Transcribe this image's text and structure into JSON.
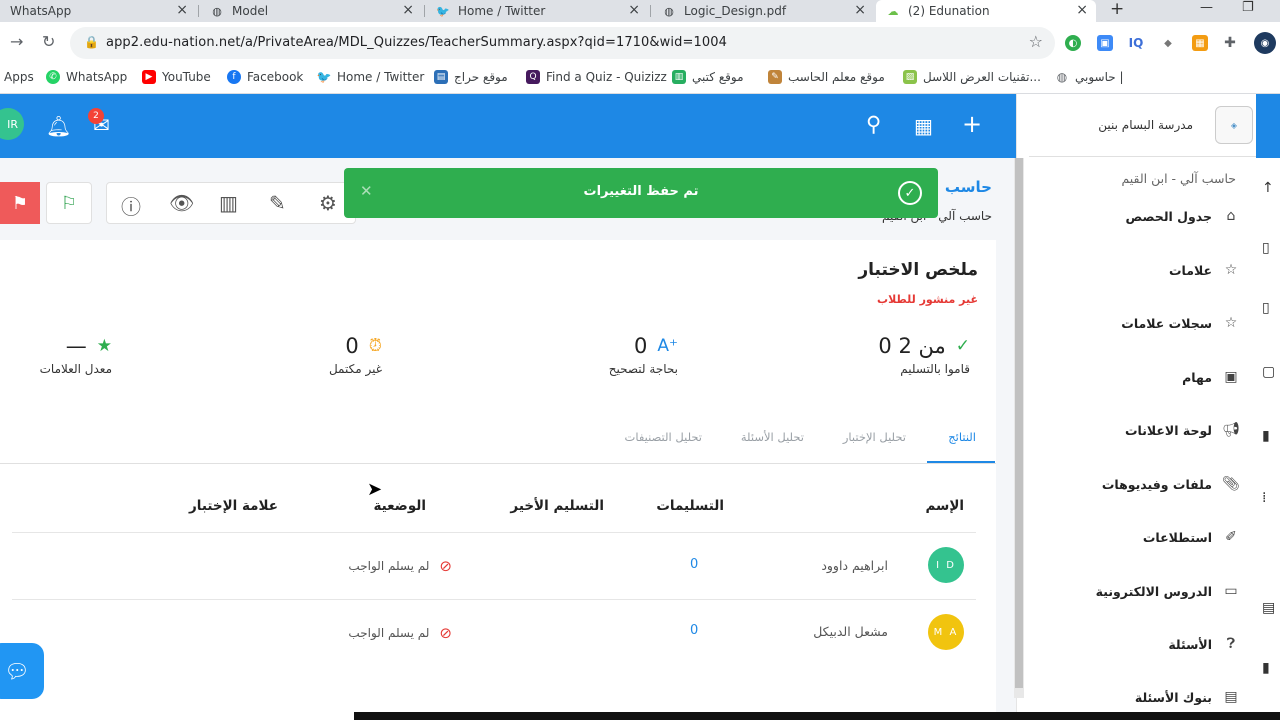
{
  "browser": {
    "tabs": [
      {
        "title": "WhatsApp",
        "icon": "whatsapp-icon"
      },
      {
        "title": "Model",
        "icon": "globe-icon"
      },
      {
        "title": "Home / Twitter",
        "icon": "twitter-icon"
      },
      {
        "title": "Logic_Design.pdf",
        "icon": "globe-icon"
      },
      {
        "title": "(2) Edunation",
        "icon": "edunation-icon"
      }
    ],
    "url": "app2.edu-nation.net/a/PrivateArea/MDL_Quizzes/TeacherSummary.aspx?qid=1710&wid=1004",
    "bookmarks": [
      {
        "label": "Apps"
      },
      {
        "label": "WhatsApp"
      },
      {
        "label": "YouTube"
      },
      {
        "label": "Facebook"
      },
      {
        "label": "Home / Twitter"
      },
      {
        "label": "موقع حراج"
      },
      {
        "label": "Find a Quiz - Quizizz"
      },
      {
        "label": "موقع كتبي"
      },
      {
        "label": "موقع معلم الحاسب"
      },
      {
        "label": "تقنيات العرض اللاسل..."
      },
      {
        "label": "حاسوبي |"
      }
    ]
  },
  "header": {
    "avatar_initials": "IR",
    "mail_badge": "2"
  },
  "sidebar": {
    "school_name": "مدرسة البسام بنين",
    "course_sub": "حاسب آلي - ابن القيم",
    "items": [
      {
        "label": "جدول الحصص",
        "icon": "home-icon"
      },
      {
        "label": "علامات",
        "icon": "star-icon"
      },
      {
        "label": "سجلات علامات",
        "icon": "star-icon"
      },
      {
        "label": "مهام",
        "icon": "calendar-icon"
      },
      {
        "label": "لوحة الاعلانات",
        "icon": "megaphone-icon"
      },
      {
        "label": "ملفات وفيديوهات",
        "icon": "paperclip-icon"
      },
      {
        "label": "استطلاعات",
        "icon": "survey-icon"
      },
      {
        "label": "الدروس الالكترونية",
        "icon": "video-icon"
      },
      {
        "label": "الأسئلة",
        "icon": "question-icon"
      },
      {
        "label": "بنوك الأسئلة",
        "icon": "question-bank-icon"
      }
    ]
  },
  "course": {
    "title": "حاسب",
    "subtitle": "حاسب آلي - ابن القيم"
  },
  "toast": {
    "message": "تم حفظ التغييرات"
  },
  "quiz": {
    "title": "ملخص الاختبار",
    "status": "غير منشور للطلاب",
    "stats": [
      {
        "value": "0 من 2",
        "label": "قاموا بالتسليم",
        "icon": "check-circle-icon"
      },
      {
        "value": "0",
        "label": "بحاجة لتصحيح",
        "icon": "grade-plus-icon"
      },
      {
        "value": "0",
        "label": "غير مكتمل",
        "icon": "alarm-icon"
      },
      {
        "value": "—",
        "label": "معدل العلامات",
        "icon": "star-icon"
      }
    ],
    "tabs": [
      {
        "label": "النتائج",
        "active": true
      },
      {
        "label": "تحليل الإختبار",
        "active": false
      },
      {
        "label": "تحليل الأسئلة",
        "active": false
      },
      {
        "label": "تحليل التصنيفات",
        "active": false
      }
    ],
    "columns": [
      "الإسم",
      "التسليمات",
      "التسليم الأخير",
      "الوضعية",
      "علامة الإختبار"
    ],
    "rows": [
      {
        "initials": "I D",
        "name": "ابراهيم داوود",
        "submissions": "0",
        "status": "لم يسلم الواجب",
        "color": "#34c38f"
      },
      {
        "initials": "M A",
        "name": "مشعل الدبيكل",
        "submissions": "0",
        "status": "لم يسلم الواجب",
        "color": "#f1c40f"
      }
    ]
  },
  "colors": {
    "primary": "#1e88e5",
    "success": "#2fae4f",
    "danger": "#e53935"
  }
}
